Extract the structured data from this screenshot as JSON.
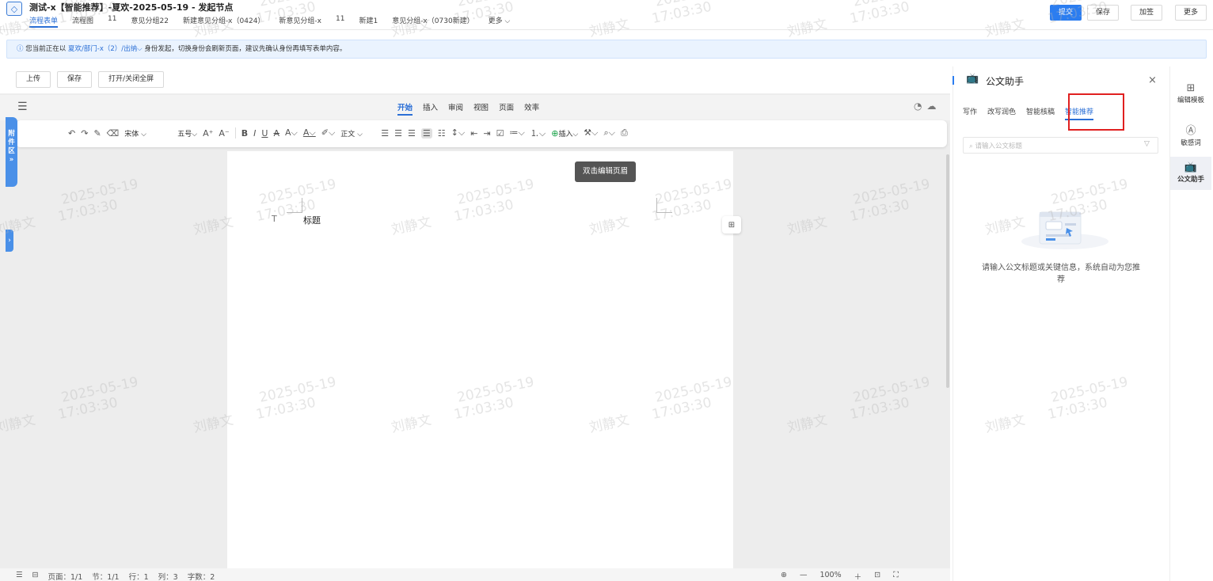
{
  "header": {
    "title": "测试-x【智能推荐】-夏欢-2025-05-19 - 发起节点",
    "tabs": [
      "流程表单",
      "流程图",
      "11",
      "意见分组22",
      "新建意见分组-x（0424）",
      "新意见分组-x",
      "11",
      "新建1",
      "意见分组-x（0730新建）",
      "更多"
    ],
    "buttons": {
      "submit": "提交",
      "save": "保存",
      "sign": "加签",
      "more": "更多"
    }
  },
  "notice": {
    "prefix": "您当前正在以",
    "identity": "夏欢/部门-x（2）/出纳",
    "suffix": "身份发起，切换身份会刷新页面，建议先确认身份再填写表单内容。"
  },
  "actions": {
    "upload": "上传",
    "save": "保存",
    "fullscreen": "打开/关闭全屏"
  },
  "editor": {
    "menu_tabs": [
      "开始",
      "插入",
      "审阅",
      "视图",
      "页面",
      "效率"
    ],
    "toolbar": {
      "font": "宋体",
      "size": "五号",
      "style": "正文",
      "insert": "插入"
    },
    "tooltip": "双击编辑页眉",
    "heading_text": "标题",
    "attach_tab": "附件区"
  },
  "status": {
    "page": "页面：1/1",
    "section": "节：1/1",
    "row": "行：1",
    "col": "列：3",
    "chars": "字数：2",
    "zoom": "100%"
  },
  "assistant": {
    "title": "公文助手",
    "tabs": [
      "写作",
      "改写润色",
      "智能核稿",
      "智能推荐"
    ],
    "search_placeholder": "请输入公文标题",
    "empty_text": "请输入公文标题或关键信息，系统自动为您推荐"
  },
  "rail": {
    "edit_template": "编辑模板",
    "sensitive": "敏感词",
    "assistant": "公文助手"
  },
  "watermark": {
    "name": "刘静文",
    "date": "2025-05-19",
    "time": "17:03:30"
  }
}
